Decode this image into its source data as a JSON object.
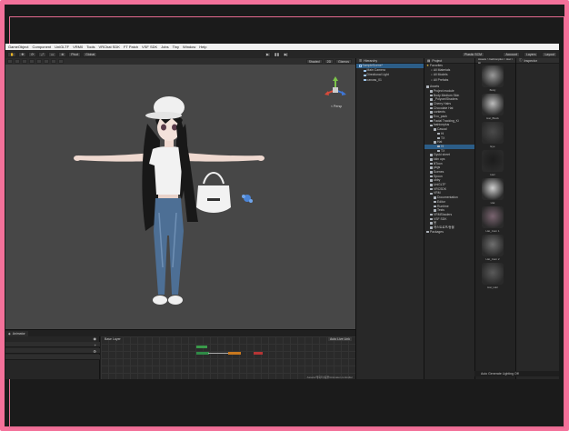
{
  "menu": [
    "GameObject",
    "Component",
    "UniGLTF",
    "VRM0",
    "Tools",
    "VRChat SDK",
    "FT Patch",
    "VSF SDK",
    "Jobs",
    "Tiny",
    "Window",
    "Help"
  ],
  "toolbar": {
    "pivot": "Pivot",
    "global": "Global",
    "play_icons": [
      "play-icon",
      "pause-icon",
      "step-icon"
    ],
    "plastic": "Plastic SCM",
    "account": "Account",
    "layers": "Layers",
    "layout": "Layout"
  },
  "scene": {
    "shading": "Shaded",
    "mode_2d": "2D",
    "gizmos": "Gizmos",
    "persp": "< Persp"
  },
  "animator": {
    "tab": "Animator",
    "base_layer": "Base Layer",
    "auto_live_link": "Auto Live Link",
    "footer": "Assets/캐릭터/동물/Animator.controller"
  },
  "hierarchy": {
    "tab": "Hierarchy",
    "items": [
      {
        "label": "SampleScene*",
        "depth": 0,
        "selected": true
      },
      {
        "label": "Main Camera",
        "depth": 1,
        "selected": false
      },
      {
        "label": "Directional Light",
        "depth": 1,
        "selected": false
      },
      {
        "label": "canvas_01",
        "depth": 1,
        "selected": false
      }
    ]
  },
  "project": {
    "tab": "Project",
    "favorites_header": "Favorites",
    "favorites": [
      "All Materials",
      "All Models",
      "All Prefabs"
    ],
    "assets_header": "Assets",
    "assets": [
      {
        "label": "Project module",
        "depth": 1
      },
      {
        "label": "Body Medium Skin",
        "depth": 1
      },
      {
        "label": "_PoiyomiShaders",
        "depth": 1
      },
      {
        "label": "Cherry Hairs",
        "depth": 1
      },
      {
        "label": "Chocolate Hat",
        "depth": 1
      },
      {
        "label": "contents",
        "depth": 1
      },
      {
        "label": "Exo_pack",
        "depth": 1
      },
      {
        "label": "Facial Tracking_Ki",
        "depth": 1
      },
      {
        "label": "fashionplus",
        "depth": 1
      },
      {
        "label": "Casual",
        "depth": 2
      },
      {
        "label": "Hi",
        "depth": 3
      },
      {
        "label": "TX",
        "depth": 3
      },
      {
        "label": "Hat",
        "depth": 2
      },
      {
        "label": "Hi",
        "depth": 3,
        "selected": true
      },
      {
        "label": "TX",
        "depth": 3
      },
      {
        "label": "Gyuki sheet",
        "depth": 1
      },
      {
        "label": "kkin ups",
        "depth": 1
      },
      {
        "label": "lilToon",
        "depth": 1
      },
      {
        "label": "pkgs",
        "depth": 1
      },
      {
        "label": "Scenes",
        "depth": 1
      },
      {
        "label": "Spoon",
        "depth": 1
      },
      {
        "label": "ubby",
        "depth": 1
      },
      {
        "label": "UniGLTF",
        "depth": 1
      },
      {
        "label": "VRCSDK",
        "depth": 1
      },
      {
        "label": "VRM",
        "depth": 1
      },
      {
        "label": "Documentation",
        "depth": 2
      },
      {
        "label": "Editor",
        "depth": 2
      },
      {
        "label": "Runtime",
        "depth": 2
      },
      {
        "label": "Tests",
        "depth": 2
      },
      {
        "label": "VRMShaders",
        "depth": 1
      },
      {
        "label": "VSF SDK",
        "depth": 1
      },
      {
        "label": "봄",
        "depth": 1
      },
      {
        "label": "캐스트로프/동물",
        "depth": 1
      }
    ],
    "packages_header": "Packages"
  },
  "favorites_panel": {
    "path": "Assets > fashionplus > Hat > Hi",
    "items": [
      "Body",
      "Hat_Black",
      "Eye",
      "Hair",
      "Hat",
      "Hat_Cam 1",
      "Hat_Cam 2",
      "Hat_Hair"
    ]
  },
  "inspector": {
    "tab": "Inspector"
  },
  "status": "Auto Generate Lighting Off",
  "colors": {
    "frame": "#f3719a",
    "scene_bg": "#474747",
    "selection": "#2c5d87",
    "jeans": "#4d6f95",
    "hat": "#f0f0f0"
  }
}
